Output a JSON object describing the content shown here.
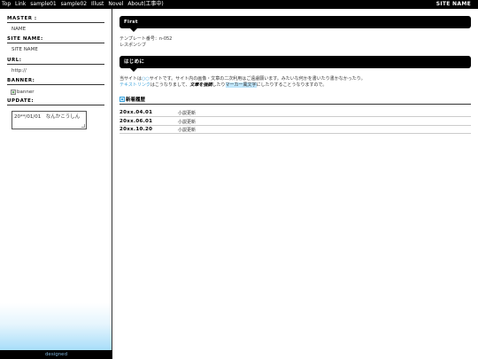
{
  "topbar": {
    "nav": [
      "Top",
      "Link",
      "sample01",
      "sample02",
      "Illust",
      "Novel",
      "About(工事中)"
    ],
    "site_name": "SITE NAME"
  },
  "sidebar": {
    "master": {
      "heading": "MASTER :",
      "value": "NAME"
    },
    "site_name": {
      "heading": "SITE NAME:",
      "value": "SITE NAME"
    },
    "url": {
      "heading": "URL:",
      "value": "http://"
    },
    "banner": {
      "heading": "BANNER:",
      "alt": "banner"
    },
    "update": {
      "heading": "UPDATE:",
      "text": "20**/01/01　なんかこうしん"
    },
    "footer": "designed"
  },
  "main": {
    "section1": {
      "title": "First",
      "line1": "テンプレート番号：n-052",
      "line2": "レスポンシブ"
    },
    "section2": {
      "title": "はじめに",
      "p1_a": "当サイトは",
      "p1_link": "○○",
      "p1_b": "サイトです。サイト内の画像・文章の二次利用はご遠慮願います。みたいな何かを書いたり書かなかったり。",
      "p2_link": "テキストリンク",
      "p2_a": "はこうなりまして、",
      "p2_bold": "文章を強調",
      "p2_b": "したり",
      "p2_mark": "マーカー風文字",
      "p2_c": "にしたりすることうなりますので。"
    },
    "news": {
      "title": "新着履歴",
      "rows": [
        {
          "date": "20xx.04.01",
          "text": "小説更新"
        },
        {
          "date": "20xx.06.01",
          "text": "小説更新"
        },
        {
          "date": "20xx.10.20",
          "text": "小説更新"
        }
      ]
    }
  },
  "colors": {
    "accent": "#3da3dc",
    "bar": "#000000",
    "gradient_end": "#8fd4f7"
  }
}
